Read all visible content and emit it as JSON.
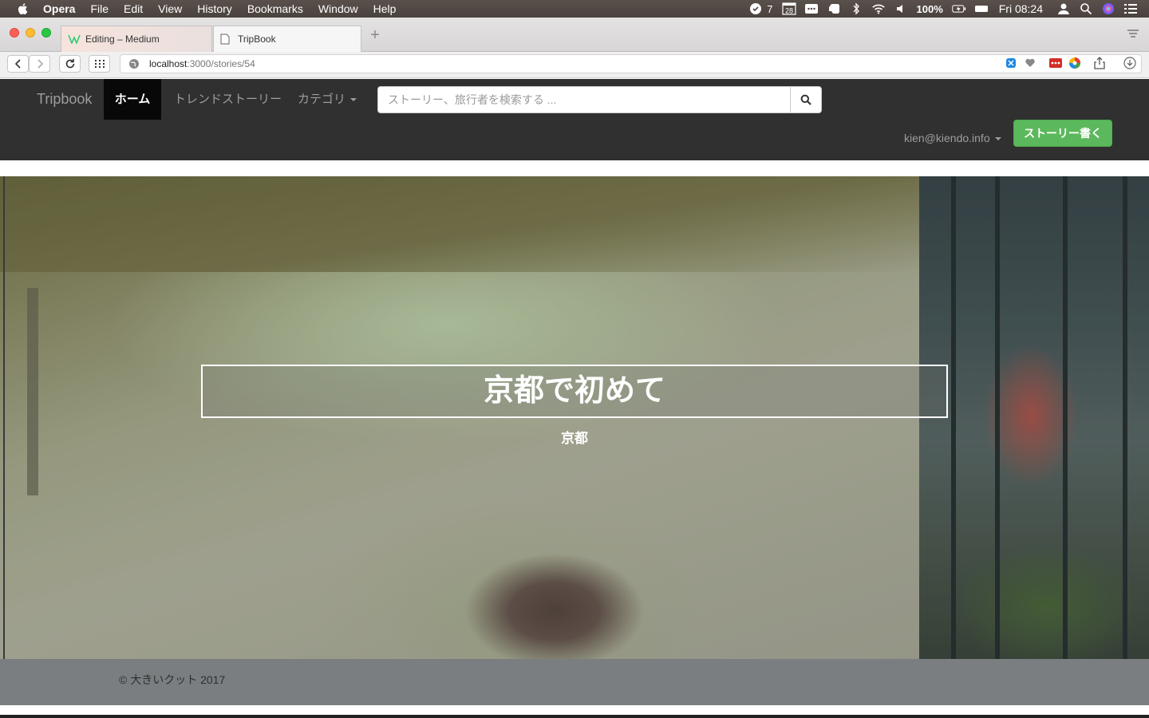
{
  "os_menubar": {
    "items": [
      "Opera",
      "File",
      "Edit",
      "View",
      "History",
      "Bookmarks",
      "Window",
      "Help"
    ],
    "badge_count": "7",
    "calendar_day": "28",
    "battery": "100%",
    "clock": "Fri 08:24"
  },
  "browser": {
    "tabs": [
      {
        "label": "Editing – Medium",
        "icon": "medium-icon",
        "active": false
      },
      {
        "label": "TripBook",
        "icon": "page-icon",
        "active": true
      }
    ],
    "new_tab_symbol": "+",
    "url_host": "localhost",
    "url_path": ":3000/stories/54"
  },
  "app": {
    "brand": "Tripbook",
    "nav": {
      "home": "ホーム",
      "trend": "トレンドストーリー",
      "category": "カテゴリ"
    },
    "search": {
      "placeholder": "ストーリー、旅行者を検索する ..."
    },
    "user_email": "kien@kiendo.info",
    "write_button": "ストーリー書く"
  },
  "story": {
    "title": "京都で初めて",
    "location": "京都"
  },
  "footer": {
    "copyright": "© 大きいクット 2017"
  },
  "colors": {
    "navbar_bg": "#303030",
    "navbar_active_bg": "#080808",
    "write_button_bg": "#5cb85c",
    "footer_bg": "#7a7e80"
  }
}
